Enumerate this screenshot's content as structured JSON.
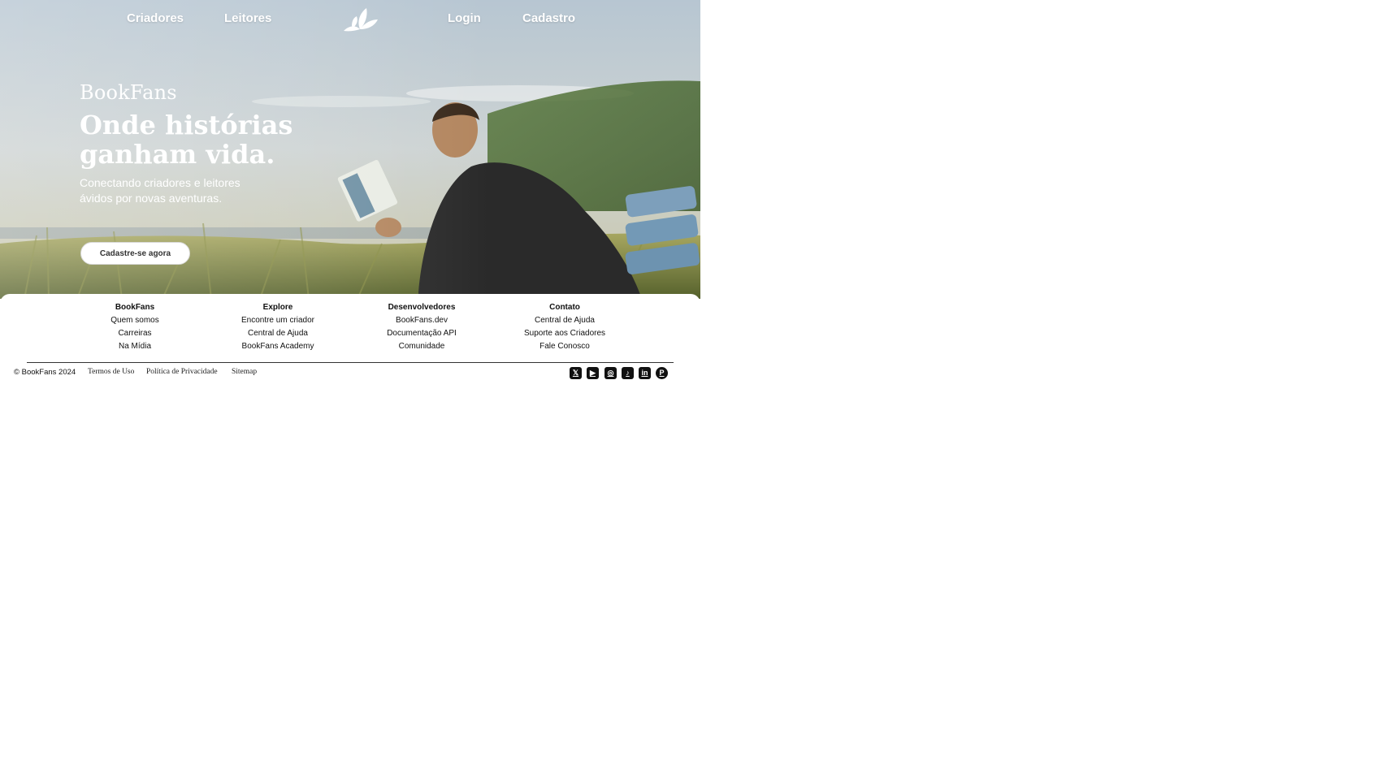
{
  "nav": {
    "creators": "Criadores",
    "readers": "Leitores",
    "login": "Login",
    "signup": "Cadastro",
    "logo_icon": "leaf-book-icon"
  },
  "hero": {
    "brand": "BookFans",
    "headline_line1": "Onde histórias",
    "headline_line2": "ganham vida.",
    "subtitle": "Conectando criadores e leitores ávidos por novas aventuras.",
    "cta": "Cadastre-se agora"
  },
  "footer": {
    "columns": [
      {
        "title": "BookFans",
        "links": [
          "Quem somos",
          "Carreiras",
          "Na Mídia"
        ]
      },
      {
        "title": "Explore",
        "links": [
          "Encontre um criador",
          "Central de Ajuda",
          "BookFans Academy"
        ]
      },
      {
        "title": "Desenvolvedores",
        "links": [
          "BookFans.dev",
          "Documentação API",
          "Comunidade"
        ]
      },
      {
        "title": "Contato",
        "links": [
          "Central de Ajuda",
          "Suporte aos Criadores",
          "Fale Conosco"
        ]
      }
    ],
    "copyright": "© BookFans 2024",
    "legal": [
      "Termos de Uso",
      "Política de Privacidade",
      "Sitemap"
    ],
    "social": [
      {
        "icon": "x-twitter-icon",
        "glyph": "𝕏"
      },
      {
        "icon": "youtube-icon",
        "glyph": "▶"
      },
      {
        "icon": "instagram-icon",
        "glyph": "◎"
      },
      {
        "icon": "tiktok-icon",
        "glyph": "♪"
      },
      {
        "icon": "linkedin-icon",
        "glyph": "in"
      },
      {
        "icon": "pinterest-icon",
        "glyph": "P"
      }
    ]
  },
  "colors": {
    "text_on_hero": "#ffffff",
    "footer_text": "#111111",
    "cta_background": "#ffffff"
  }
}
